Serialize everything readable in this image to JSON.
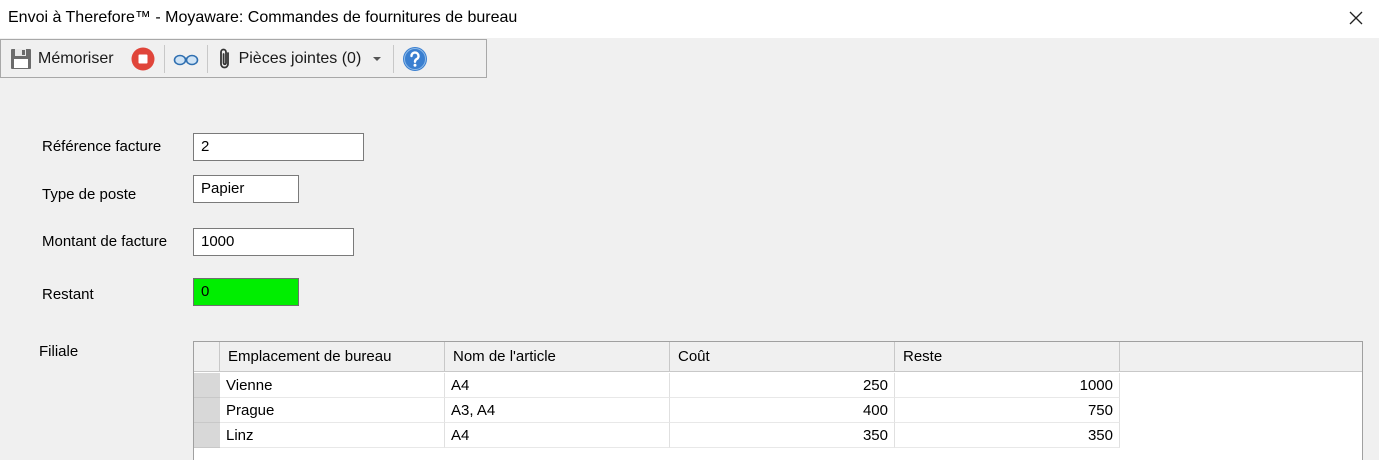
{
  "window": {
    "title": "Envoi à Therefore™ - Moyaware: Commandes de fournitures de bureau"
  },
  "toolbar": {
    "save_label": "Mémoriser",
    "attachments_label": "Pièces jointes (0)"
  },
  "form": {
    "invoice_ref_label": "Référence facture",
    "invoice_ref_value": "2",
    "post_type_label": "Type de poste",
    "post_type_value": "Papier",
    "amount_label": "Montant de facture",
    "amount_value": "1000",
    "remaining_label": "Restant",
    "remaining_value": "0",
    "branch_label": "Filiale"
  },
  "table": {
    "columns": [
      "Emplacement de bureau",
      "Nom de l'article",
      "Coût",
      "Reste"
    ],
    "rows": [
      [
        "Vienne",
        "A4",
        "250",
        "1000"
      ],
      [
        "Prague",
        "A3, A4",
        "400",
        "750"
      ],
      [
        "Linz",
        "A4",
        "350",
        "350"
      ]
    ]
  },
  "colors": {
    "remaining_ok": "#00ee00",
    "stop": "#e0453a",
    "help": "#3a7fd0"
  }
}
